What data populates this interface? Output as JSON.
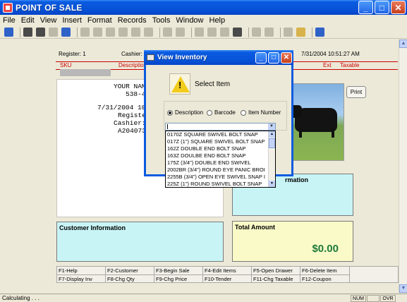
{
  "app": {
    "title": "POINT OF SALE"
  },
  "menu": [
    "File",
    "Edit",
    "View",
    "Insert",
    "Format",
    "Records",
    "Tools",
    "Window",
    "Help"
  ],
  "header": {
    "register": "Register: 1",
    "cashier": "Cashier:",
    "datetime": "7/31/2004 10:51:27 AM"
  },
  "columns": {
    "sku": "SKU",
    "description": "Description",
    "ext": "Ext",
    "taxable": "Taxable"
  },
  "receipt": {
    "line1": "YOUR NAM",
    "line2": "538-4",
    "line3": "7/31/2004 10",
    "line4": "Registe",
    "line5": "Cashier:",
    "line6": "A204073"
  },
  "print_button": "Print",
  "info_panel": {
    "title": "rmation"
  },
  "customer_panel": {
    "title": "Customer Information"
  },
  "total_panel": {
    "title": "Total Amount",
    "amount": "$0.00"
  },
  "function_keys": {
    "row1": [
      "F1-Help",
      "F2-Customer",
      "F3-Begin Sale",
      "F4-Edit Items",
      "F5-Open Drawer",
      "F6-Delete Item"
    ],
    "row2": [
      "F7-Display Inv",
      "F8-Chg Qty",
      "F9-Chg Price",
      "F10-Tender",
      "F11-Chg Taxable",
      "F12-Coupon"
    ]
  },
  "status": {
    "text": "Calculating . . .",
    "num": "NUM",
    "ovr": "OVR"
  },
  "dialog": {
    "title": "View Inventory",
    "prompt": "Select Item",
    "radio_description": "Description",
    "radio_barcode": "Barcode",
    "radio_item_number": "Item Number",
    "combo_value": "",
    "items": [
      "0170Z SQUARE SWIVEL BOLT SNAP",
      "017Z (1\") SQUARE SWIVEL BOLT SNAP",
      "162Z DOUBLE END BOLT SNAP",
      "163Z DOULBE END BOLT SNAP",
      "175Z (3/4\") DOUBLE END SWIVEL",
      "2002BR (3/4\") ROUND EYE PANIC BROI",
      "2255B (3/4\") OPEN EYE SWIVEL SNAP I",
      "225Z (1\") ROUND SWIVEL BOLT SNAP"
    ]
  },
  "colors": {
    "accent": "#0a5be0",
    "panel_cyan": "#c8f4f6",
    "panel_yellow": "#fafac8",
    "amount_green": "#1e7a3a",
    "header_red": "#cc0000"
  }
}
